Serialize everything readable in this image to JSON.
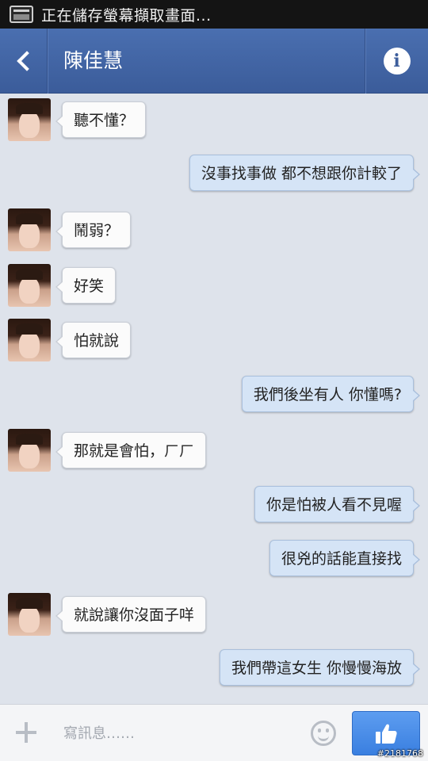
{
  "status_bar": {
    "notification_text": "正在儲存螢幕擷取畫面..."
  },
  "header": {
    "contact_name": "陳佳慧",
    "info_label": "i"
  },
  "messages": [
    {
      "side": "in",
      "text": "聽不懂？"
    },
    {
      "side": "out",
      "text": "沒事找事做  都不想跟你計較了"
    },
    {
      "side": "in",
      "text": "鬧弱？"
    },
    {
      "side": "in",
      "text": "好笑"
    },
    {
      "side": "in",
      "text": "怕就說"
    },
    {
      "side": "out",
      "text": "我們後坐有人 你懂嗎?"
    },
    {
      "side": "in",
      "text": "那就是會怕，ㄏㄏ"
    },
    {
      "side": "out",
      "text": "你是怕被人看不見喔"
    },
    {
      "side": "out",
      "text": "很兇的話能直接找"
    },
    {
      "side": "in",
      "text": "就說讓你沒面子咩"
    },
    {
      "side": "out",
      "text": "我們帶這女生 你慢慢海放"
    }
  ],
  "composer": {
    "placeholder": "寫訊息……"
  },
  "watermark": "#2181768",
  "colors": {
    "header": "#3f62a3",
    "incoming_bubble": "#fbfbfb",
    "outgoing_bubble": "#d5e4f6",
    "like_button": "#4a8ee8"
  },
  "icons": {
    "status": "screenshot-icon",
    "back": "back-chevron-icon",
    "info": "info-icon",
    "add": "plus-icon",
    "emoji": "emoji-icon",
    "send": "thumbs-up-icon"
  }
}
